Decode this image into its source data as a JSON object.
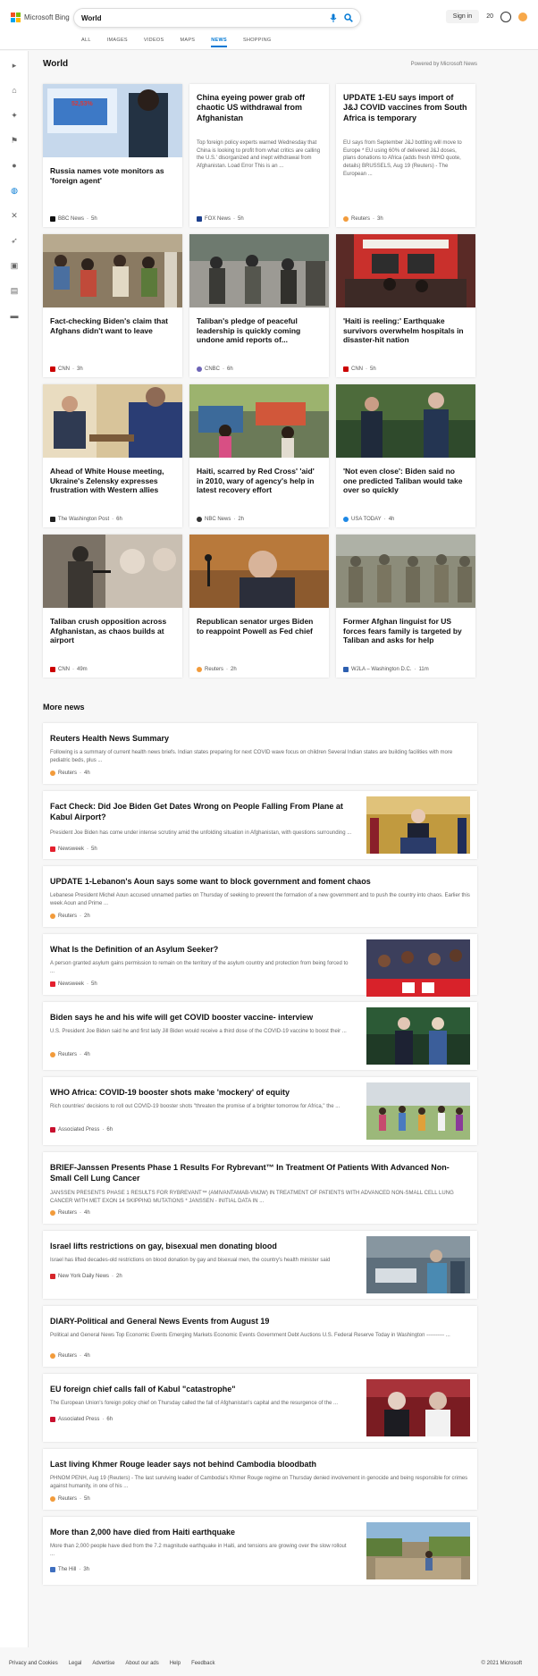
{
  "header": {
    "brand": "Microsoft Bing",
    "search_value": "World",
    "sign_in": "Sign in",
    "rewards_count": "20"
  },
  "nav": {
    "tabs": [
      "ALL",
      "IMAGES",
      "VIDEOS",
      "MAPS",
      "NEWS",
      "SHOPPING"
    ],
    "active": "NEWS"
  },
  "section": {
    "title": "World",
    "powered": "Powered by Microsoft News"
  },
  "top_cards": [
    {
      "title": "Russia names vote monitors as 'foreign agent'",
      "source": "BBC News",
      "age": "5h",
      "logo_color": "#111111"
    },
    {
      "title": "China eyeing power grab off chaotic US withdrawal from Afghanistan",
      "snippet": "Top foreign policy experts warned Wednesday that China is looking to profit from what critics are calling the U.S.' disorganized and inept withdrawal from Afghanistan. Load Error This is an ...",
      "source": "FOX News",
      "age": "5h",
      "logo_color": "#1c3f8c"
    },
    {
      "title": "UPDATE 1-EU says import of J&J COVID vaccines from South Africa is temporary",
      "snippet": "EU says from September J&J bottling will move to Europe * EU using 60% of delivered J&J doses, plans donations to Africa (adds fresh WHO quote, details) BRUSSELS, Aug 19 (Reuters) - The European ...",
      "source": "Reuters",
      "age": "3h",
      "logo_color": "#f29b3b"
    },
    {
      "title": "Fact-checking Biden's claim that Afghans didn't want to leave",
      "source": "CNN",
      "age": "3h",
      "logo_color": "#cc0000"
    },
    {
      "title": "Taliban's pledge of peaceful leadership is quickly coming undone amid reports of...",
      "source": "CNBC",
      "age": "6h",
      "logo_color": "#6c63b6"
    },
    {
      "title": "'Haiti is reeling:' Earthquake survivors overwhelm hospitals in disaster-hit nation",
      "source": "CNN",
      "age": "5h",
      "logo_color": "#cc0000"
    },
    {
      "title": "Ahead of White House meeting, Ukraine's Zelensky expresses frustration with Western allies",
      "source": "The Washington Post",
      "age": "6h",
      "logo_color": "#222222"
    },
    {
      "title": "Haiti, scarred by Red Cross' 'aid' in 2010, wary of agency's help in latest recovery effort",
      "source": "NBC News",
      "age": "2h",
      "logo_color": "#333333"
    },
    {
      "title": "'Not even close': Biden said no one predicted Taliban would take over so quickly",
      "source": "USA TODAY",
      "age": "4h",
      "logo_color": "#1e88e5"
    },
    {
      "title": "Taliban crush opposition across Afghanistan, as chaos builds at airport",
      "source": "CNN",
      "age": "49m",
      "logo_color": "#cc0000"
    },
    {
      "title": "Republican senator urges Biden to reappoint Powell as Fed chief",
      "source": "Reuters",
      "age": "2h",
      "logo_color": "#f29b3b"
    },
    {
      "title": "Former Afghan linguist for US forces fears family is targeted by Taliban and asks for help",
      "source": "WJLA – Washington D.C.",
      "age": "11m",
      "logo_color": "#2d5fb0"
    }
  ],
  "more_news": {
    "title": "More news",
    "items": [
      {
        "title": "Reuters Health News Summary",
        "snippet": "Following is a summary of current health news briefs. Indian states preparing for next COVID wave focus on children Several Indian states are building facilities with more pediatric beds, plus ...",
        "source": "Reuters",
        "age": "4h",
        "logo_color": "#f29b3b"
      },
      {
        "title": "Fact Check: Did Joe Biden Get Dates Wrong on People Falling From Plane at Kabul Airport?",
        "snippet": "President Joe Biden has come under intense scrutiny amid the unfolding situation in Afghanistan, with questions surrounding ...",
        "source": "Newsweek",
        "age": "5h",
        "logo_color": "#e4202e"
      },
      {
        "title": "UPDATE 1-Lebanon's Aoun says some want to block government and foment chaos",
        "snippet": "Lebanese President Michel Aoun accused unnamed parties on Thursday of seeking to prevent the formation of a new government and to push the country into chaos. Earlier this week Aoun and Prime ...",
        "source": "Reuters",
        "age": "2h",
        "logo_color": "#f29b3b"
      },
      {
        "title": "What Is the Definition of an Asylum Seeker?",
        "snippet": "A person granted asylum gains permission to remain on the territory of the asylum country and protection from being forced to ...",
        "source": "Newsweek",
        "age": "5h",
        "logo_color": "#e4202e"
      },
      {
        "title": "Biden says he and his wife will get COVID booster vaccine- interview",
        "snippet": "U.S. President Joe Biden said he and first lady Jill Biden would receive a third dose of the COVID-19 vaccine to boost their ...",
        "source": "Reuters",
        "age": "4h",
        "logo_color": "#f29b3b"
      },
      {
        "title": "WHO Africa: COVID-19 booster shots make 'mockery' of equity",
        "snippet": "Rich countries' decisions to roll out COVID-19 booster shots \"threaten the promise of a brighter tomorrow for Africa,\" the ...",
        "source": "Associated Press",
        "age": "6h",
        "logo_color": "#c8102e"
      },
      {
        "title": "BRIEF-Janssen Presents Phase 1 Results For Rybrevant™ In Treatment Of Patients With Advanced Non-Small Cell Lung Cancer",
        "snippet": "JANSSEN PRESENTS PHASE 1 RESULTS FOR RYBREVANT™ (AMIVANTAMAB-VMJW) IN TREATMENT OF PATIENTS WITH ADVANCED NON-SMALL CELL LUNG CANCER WITH MET EXON 14 SKIPPING MUTATIONS * JANSSEN - INITIAL DATA IN ...",
        "source": "Reuters",
        "age": "4h",
        "logo_color": "#f29b3b"
      },
      {
        "title": "Israel lifts restrictions on gay, bisexual men donating blood",
        "snippet": "Israel has lifted decades-old restrictions on blood donation by gay and bisexual men, the country's health minister said",
        "source": "New York Daily News",
        "age": "2h",
        "logo_color": "#d6262b"
      },
      {
        "title": "DIARY-Political and General News Events from August 19",
        "snippet": "Political and General News Top Economic Events Emerging Markets Economic Events Government Debt Auctions U.S. Federal Reserve Today in Washington ---------- ...",
        "source": "Reuters",
        "age": "4h",
        "logo_color": "#f29b3b"
      },
      {
        "title": "EU foreign chief calls fall of Kabul \"catastrophe\"",
        "snippet": "The European Union's foreign policy chief on Thursday called the fall of Afghanistan's capital and the resurgence of the ...",
        "source": "Associated Press",
        "age": "6h",
        "logo_color": "#c8102e"
      },
      {
        "title": "Last living Khmer Rouge leader says not behind Cambodia bloodbath",
        "snippet": "PHNOM PENH, Aug 19 (Reuters) - The last surviving leader of Cambodia's Khmer Rouge regime on Thursday denied involvement in genocide and being responsible for crimes against humanity, in one of his ...",
        "source": "Reuters",
        "age": "5h",
        "logo_color": "#f29b3b"
      },
      {
        "title": "More than 2,000 have died from Haiti earthquake",
        "snippet": "More than 2,000 people have died from the 7.2 magnitude earthquake in Haiti, and tensions are growing over the slow rollout ...",
        "source": "The Hill",
        "age": "3h",
        "logo_color": "#3f6fbf"
      }
    ]
  },
  "image_overlay_text": "52,53%",
  "footer": {
    "links": [
      "Privacy and Cookies",
      "Legal",
      "Advertise",
      "About our ads",
      "Help",
      "Feedback"
    ],
    "copyright": "© 2021 Microsoft"
  }
}
